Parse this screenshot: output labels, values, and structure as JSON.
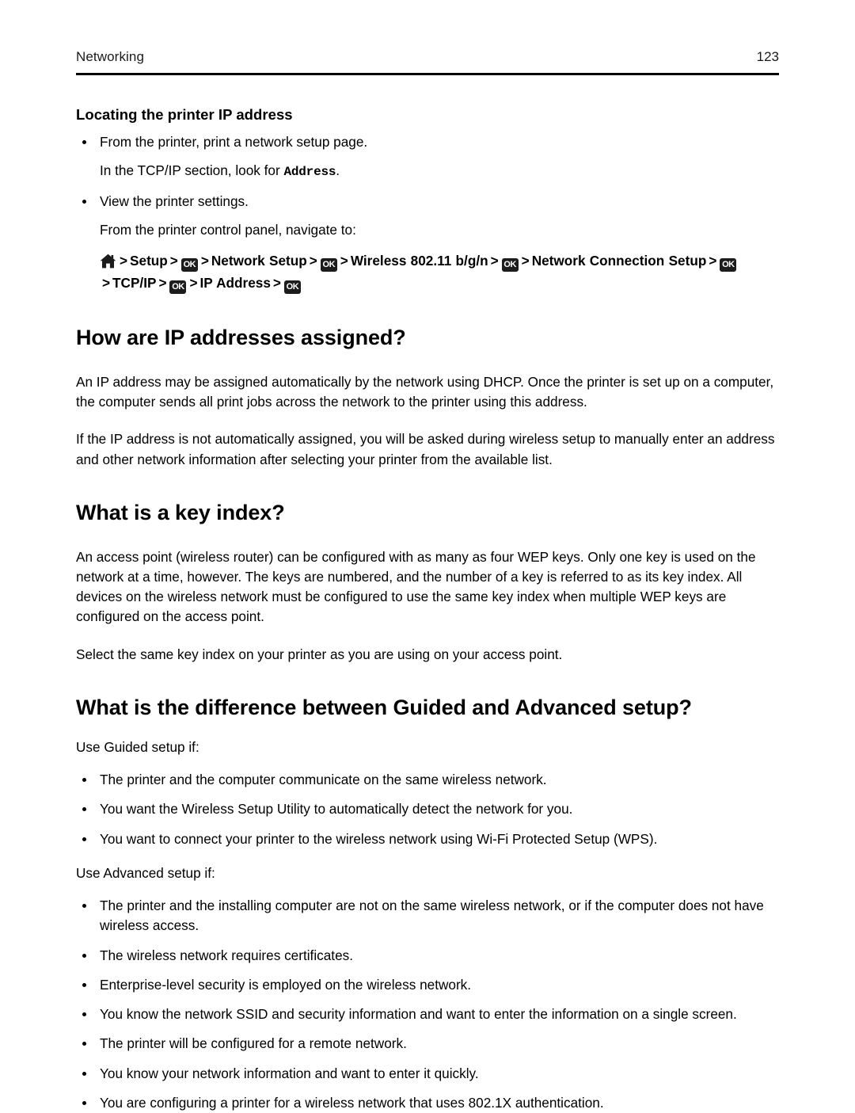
{
  "header": {
    "title": "Networking",
    "page_number": "123"
  },
  "sections": {
    "locating_ip": {
      "heading": "Locating the printer IP address",
      "bullet_1": "From the printer, print a network setup page.",
      "bullet_1_cont_before": "In the TCP/IP section, look for ",
      "bullet_1_cont_mono": "Address",
      "bullet_1_cont_after": ".",
      "bullet_2": "View the printer settings.",
      "bullet_2_cont": "From the printer control panel, navigate to:",
      "nav_path": {
        "home_icon": "home-icon",
        "ok_label": "OK",
        "separator": ">",
        "steps": [
          "Setup",
          "Network Setup",
          "Wireless 802.11 b/g/n",
          "Network Connection Setup",
          "TCP/IP",
          "IP Address"
        ]
      }
    },
    "ip_assigned": {
      "heading": "How are IP addresses assigned?",
      "paragraph_1": "An IP address may be assigned automatically by the network using DHCP. Once the printer is set up on a computer, the computer sends all print jobs across the network to the printer using this address.",
      "paragraph_2": "If the IP address is not automatically assigned, you will be asked during wireless setup to manually enter an address and other network information after selecting your printer from the available list."
    },
    "key_index": {
      "heading": "What is a key index?",
      "paragraph_1": "An access point (wireless router) can be configured with as many as four WEP keys. Only one key is used on the network at a time, however. The keys are numbered, and the number of a key is referred to as its key index. All devices on the wireless network must be configured to use the same key index when multiple WEP keys are configured on the access point.",
      "paragraph_2": "Select the same key index on your printer as you are using on your access point."
    },
    "guided_vs_advanced": {
      "heading": "What is the difference between Guided and Advanced setup?",
      "guided_intro": "Use Guided setup if:",
      "guided_bullets": [
        "The printer and the computer communicate on the same wireless network.",
        "You want the Wireless Setup Utility to automatically detect the network for you.",
        "You want to connect your printer to the wireless network using Wi-Fi Protected Setup (WPS)."
      ],
      "advanced_intro": "Use Advanced setup if:",
      "advanced_bullets": [
        "The printer and the installing computer are not on the same wireless network, or if the computer does not have wireless access.",
        "The wireless network requires certificates.",
        "Enterprise-level security is employed on the wireless network.",
        "You know the network SSID and security information and want to enter the information on a single screen.",
        "The printer will be configured for a remote network.",
        "You know your network information and want to enter it quickly.",
        "You are configuring a printer for a wireless network that uses 802.1X authentication."
      ]
    }
  }
}
